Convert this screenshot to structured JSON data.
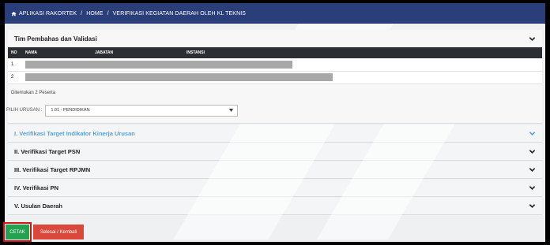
{
  "breadcrumb": {
    "items": [
      "APLIKASI RAKORTEK",
      "HOME",
      "VERIFIKASI KEGIATAN DAERAH OLEH KL TEKNIS"
    ],
    "separator": "/"
  },
  "team_panel": {
    "title": "Tim Pembahas dan Validasi",
    "columns": [
      "NO",
      "NAMA",
      "JABATAN",
      "INSTANSI"
    ],
    "rows": [
      {
        "no": "1",
        "redacted_width_pct": 67
      },
      {
        "no": "2",
        "redacted_width_pct": 77
      }
    ],
    "found_text": "Ditemukan 2 Peserta"
  },
  "filter": {
    "label": "PILIH URUSAN :",
    "selected": "1.01 - PENDIDIKAN"
  },
  "sections": [
    {
      "label": "I. Verifikasi Target Indikator Kinerja Urusan",
      "active": true
    },
    {
      "label": "II. Verifikasi Target PSN",
      "active": false
    },
    {
      "label": "III. Verifikasi Target RPJMN",
      "active": false
    },
    {
      "label": "IV. Verifikasi PN",
      "active": false
    },
    {
      "label": "V. Usulan Daerah",
      "active": false
    }
  ],
  "buttons": {
    "print": "CETAK",
    "back": "Selesai / Kembali"
  },
  "colors": {
    "topbar": "#2a3f7a",
    "active_section": "#5aa0d8",
    "print_button": "#23a352",
    "back_button": "#d9483b",
    "highlight_border": "#d0121b"
  }
}
